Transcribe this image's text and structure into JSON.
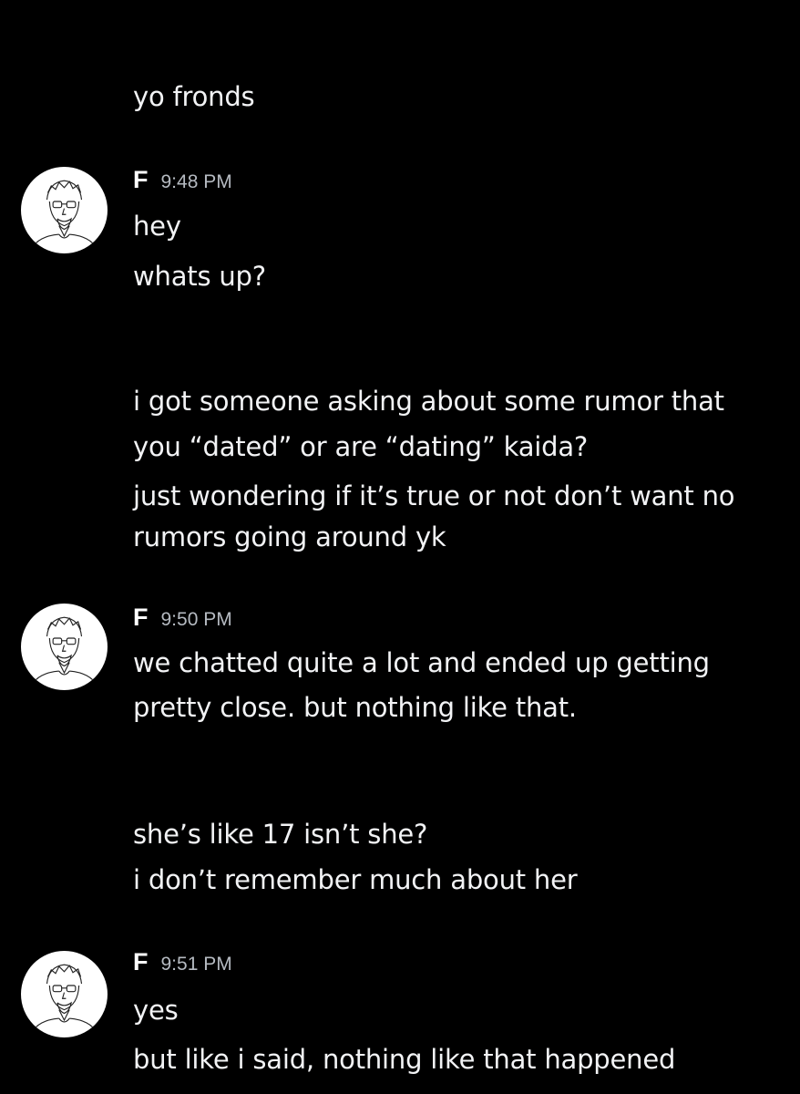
{
  "messages": [
    {
      "type": "continuation",
      "lines": [
        "yo fronds"
      ]
    },
    {
      "type": "group",
      "author": "F",
      "time": "9:48 PM",
      "lines": [
        "hey",
        "whats up?"
      ]
    },
    {
      "type": "continuation",
      "lines": [
        "i got someone asking about some rumor that",
        "you “dated” or are “dating” kaida?",
        "just wondering if it’s true or not don’t want no",
        "rumors going around yk"
      ]
    },
    {
      "type": "group",
      "author": "F",
      "time": "9:50 PM",
      "lines": [
        "we chatted quite a lot and ended up getting",
        "pretty close. but nothing like that."
      ]
    },
    {
      "type": "continuation",
      "lines": [
        "she’s like 17 isn’t she?",
        "i don’t remember much about her"
      ]
    },
    {
      "type": "group",
      "author": "F",
      "time": "9:51 PM",
      "lines": [
        "yes",
        "but like i said, nothing like that happened"
      ]
    }
  ],
  "avatar_icon": "user-sketch-avatar",
  "colors": {
    "background": "#000000",
    "text": "#f2f3f5",
    "timestamp": "#b5bac1"
  }
}
